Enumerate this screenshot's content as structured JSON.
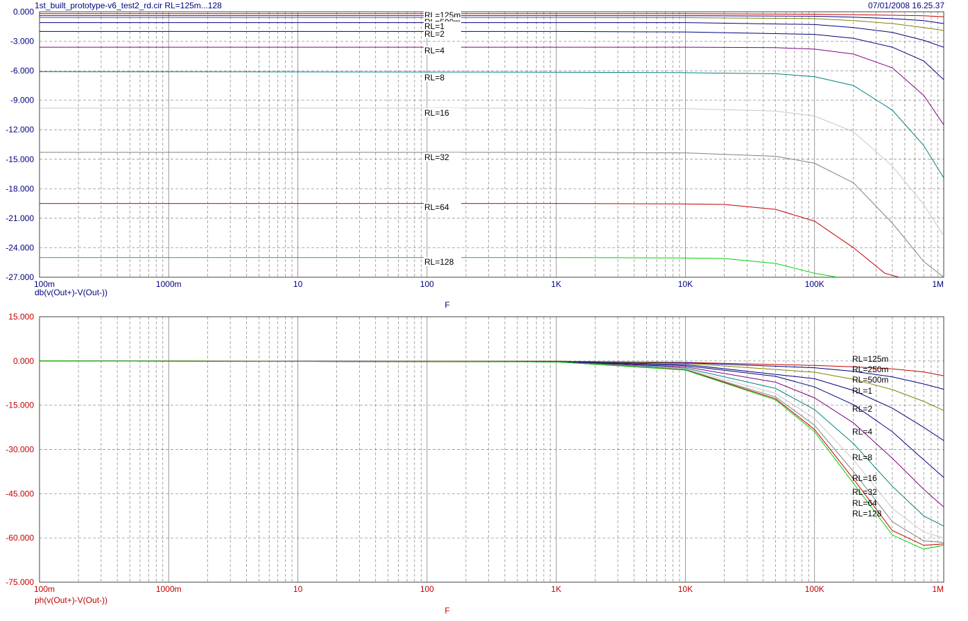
{
  "header": {
    "title": "1st_built_prototype-v6_test2_rd.cir RL=125m...128",
    "timestamp": "07/01/2008 16.25.37"
  },
  "colors": {
    "series": [
      "#c00000",
      "#000080",
      "#808000",
      "#000080",
      "#800080",
      "#008080",
      "#c0c0c0",
      "#808080",
      "#c00000",
      "#00d000"
    ],
    "grid": "#808080",
    "axis_text_top": "#000080",
    "axis_text_bottom": "#c00000"
  },
  "chart_data": [
    {
      "type": "line",
      "ylabel": "db(v(Out+)-V(Out-))",
      "xlabel": "F",
      "x_scale": "log",
      "xlim": [
        0.1,
        1000000
      ],
      "ylim": [
        -27,
        0
      ],
      "grid": true,
      "x_ticks": [
        "100m",
        "1000m",
        "10",
        "100",
        "1K",
        "10K",
        "100K",
        "1M"
      ],
      "y_ticks": [
        "0.000",
        "-3.000",
        "-6.000",
        "-9.000",
        "-12.000",
        "-15.000",
        "-18.000",
        "-21.000",
        "-24.000",
        "-27.000"
      ],
      "series": [
        {
          "name": "RL=125m",
          "x": [
            0.1,
            1000,
            10000,
            100000,
            200000,
            400000,
            700000,
            1000000
          ],
          "y": [
            -0.2,
            -0.2,
            -0.2,
            -0.25,
            -0.3,
            -0.35,
            -0.4,
            -0.5
          ]
        },
        {
          "name": "RL=250m",
          "x": [
            0.1,
            1000,
            10000,
            100000,
            200000,
            400000,
            700000,
            1000000
          ],
          "y": [
            -0.4,
            -0.4,
            -0.4,
            -0.45,
            -0.55,
            -0.7,
            -0.9,
            -1.2
          ]
        },
        {
          "name": "RL=500m",
          "x": [
            0.1,
            1000,
            10000,
            100000,
            200000,
            400000,
            700000,
            1000000
          ],
          "y": [
            -0.6,
            -0.6,
            -0.6,
            -0.7,
            -0.9,
            -1.2,
            -1.6,
            -1.9
          ]
        },
        {
          "name": "RL=1",
          "x": [
            0.1,
            1000,
            10000,
            100000,
            200000,
            400000,
            700000,
            1000000
          ],
          "y": [
            -1.1,
            -1.1,
            -1.1,
            -1.3,
            -1.6,
            -2.1,
            -2.9,
            -3.6
          ]
        },
        {
          "name": "RL=2",
          "x": [
            0.1,
            1000,
            10000,
            100000,
            200000,
            400000,
            700000,
            1000000
          ],
          "y": [
            -2.0,
            -2.0,
            -2.05,
            -2.3,
            -2.7,
            -3.6,
            -5.0,
            -6.9
          ]
        },
        {
          "name": "RL=4",
          "x": [
            0.1,
            1000,
            10000,
            50000,
            100000,
            200000,
            400000,
            700000,
            1000000
          ],
          "y": [
            -3.6,
            -3.6,
            -3.6,
            -3.65,
            -3.8,
            -4.3,
            -5.7,
            -8.5,
            -11.5
          ]
        },
        {
          "name": "RL=8",
          "x": [
            0.1,
            1000,
            10000,
            50000,
            100000,
            200000,
            400000,
            700000,
            1000000
          ],
          "y": [
            -6.1,
            -6.15,
            -6.2,
            -6.3,
            -6.6,
            -7.5,
            -10.0,
            -13.6,
            -16.9
          ]
        },
        {
          "name": "RL=16",
          "x": [
            0.1,
            1000,
            10000,
            50000,
            100000,
            200000,
            400000,
            700000,
            1000000
          ],
          "y": [
            -9.8,
            -9.8,
            -9.85,
            -10.1,
            -10.6,
            -12.2,
            -15.7,
            -19.6,
            -22.8
          ]
        },
        {
          "name": "RL=32",
          "x": [
            0.1,
            1000,
            10000,
            50000,
            100000,
            200000,
            400000,
            700000,
            1000000
          ],
          "y": [
            -14.3,
            -14.3,
            -14.35,
            -14.7,
            -15.4,
            -17.4,
            -21.5,
            -25.4,
            -27.0
          ]
        },
        {
          "name": "RL=64",
          "x": [
            0.1,
            1000,
            10000,
            20000,
            50000,
            100000,
            200000,
            350000,
            450000
          ],
          "y": [
            -19.5,
            -19.5,
            -19.55,
            -19.6,
            -20.1,
            -21.3,
            -24.0,
            -26.6,
            -27.0
          ]
        },
        {
          "name": "RL=128",
          "x": [
            0.1,
            1000,
            10000,
            20000,
            50000,
            100000,
            150000
          ],
          "y": [
            -25.0,
            -25.0,
            -25.05,
            -25.1,
            -25.6,
            -26.6,
            -27.0
          ]
        }
      ]
    },
    {
      "type": "line",
      "ylabel": "ph(v(Out+)-V(Out-))",
      "xlabel": "F",
      "x_scale": "log",
      "xlim": [
        0.1,
        1000000
      ],
      "ylim": [
        -75,
        15
      ],
      "grid": true,
      "x_ticks": [
        "100m",
        "1000m",
        "10",
        "100",
        "1K",
        "10K",
        "100K",
        "1M"
      ],
      "y_ticks": [
        "15.000",
        "0.000",
        "-15.000",
        "-30.000",
        "-45.000",
        "-60.000",
        "-75.000"
      ],
      "series": [
        {
          "name": "RL=125m",
          "x": [
            0.1,
            1000,
            10000,
            100000,
            200000,
            400000,
            700000,
            1000000
          ],
          "y": [
            0,
            -0.1,
            -0.5,
            -1.5,
            -2.0,
            -2.7,
            -3.7,
            -5.0
          ]
        },
        {
          "name": "RL=250m",
          "x": [
            0.1,
            1000,
            10000,
            100000,
            200000,
            400000,
            700000,
            1000000
          ],
          "y": [
            0,
            -0.1,
            -0.6,
            -2.3,
            -3.5,
            -5.4,
            -7.8,
            -9.6
          ]
        },
        {
          "name": "RL=500m",
          "x": [
            0.1,
            1000,
            10000,
            100000,
            200000,
            400000,
            700000,
            1000000
          ],
          "y": [
            0,
            -0.1,
            -0.8,
            -3.8,
            -6.2,
            -9.7,
            -13.7,
            -16.8
          ]
        },
        {
          "name": "RL=1",
          "x": [
            0.1,
            1000,
            10000,
            100000,
            200000,
            400000,
            700000,
            1000000
          ],
          "y": [
            0,
            -0.2,
            -1.2,
            -6.0,
            -10.0,
            -16.0,
            -22.5,
            -27.0
          ]
        },
        {
          "name": "RL=2",
          "x": [
            0.1,
            1000,
            10000,
            50000,
            100000,
            200000,
            400000,
            700000,
            1000000
          ],
          "y": [
            0,
            -0.2,
            -1.6,
            -5.2,
            -8.8,
            -14.8,
            -24.0,
            -33.5,
            -39.5
          ]
        },
        {
          "name": "RL=4",
          "x": [
            0.1,
            1000,
            10000,
            50000,
            100000,
            200000,
            400000,
            700000,
            1000000
          ],
          "y": [
            0,
            -0.3,
            -2.0,
            -7.2,
            -12.5,
            -21.0,
            -33.0,
            -43.5,
            -49.5
          ]
        },
        {
          "name": "RL=8",
          "x": [
            0.1,
            1000,
            10000,
            50000,
            100000,
            200000,
            400000,
            700000,
            1000000
          ],
          "y": [
            0,
            -0.3,
            -2.4,
            -9.3,
            -16.5,
            -28.0,
            -42.5,
            -52.5,
            -56.0
          ]
        },
        {
          "name": "RL=16",
          "x": [
            0.1,
            1000,
            10000,
            50000,
            100000,
            200000,
            400000,
            700000,
            1000000
          ],
          "y": [
            0,
            -0.3,
            -2.7,
            -11.0,
            -19.5,
            -33.5,
            -50.0,
            -58.0,
            -60.0
          ]
        },
        {
          "name": "RL=32",
          "x": [
            0.1,
            1000,
            10000,
            50000,
            100000,
            200000,
            400000,
            700000,
            1000000
          ],
          "y": [
            0,
            -0.3,
            -2.9,
            -12.2,
            -21.8,
            -37.5,
            -54.5,
            -61.0,
            -61.5
          ]
        },
        {
          "name": "RL=64",
          "x": [
            0.1,
            1000,
            10000,
            50000,
            100000,
            200000,
            400000,
            700000,
            1000000
          ],
          "y": [
            0,
            -0.3,
            -3.0,
            -12.8,
            -23.2,
            -40.0,
            -57.5,
            -62.5,
            -62.0
          ]
        },
        {
          "name": "RL=128",
          "x": [
            0.1,
            1000,
            10000,
            50000,
            100000,
            200000,
            400000,
            700000,
            1000000
          ],
          "y": [
            0,
            -0.3,
            -3.1,
            -13.2,
            -24.0,
            -41.5,
            -59.0,
            -63.8,
            -62.5
          ]
        }
      ]
    }
  ]
}
